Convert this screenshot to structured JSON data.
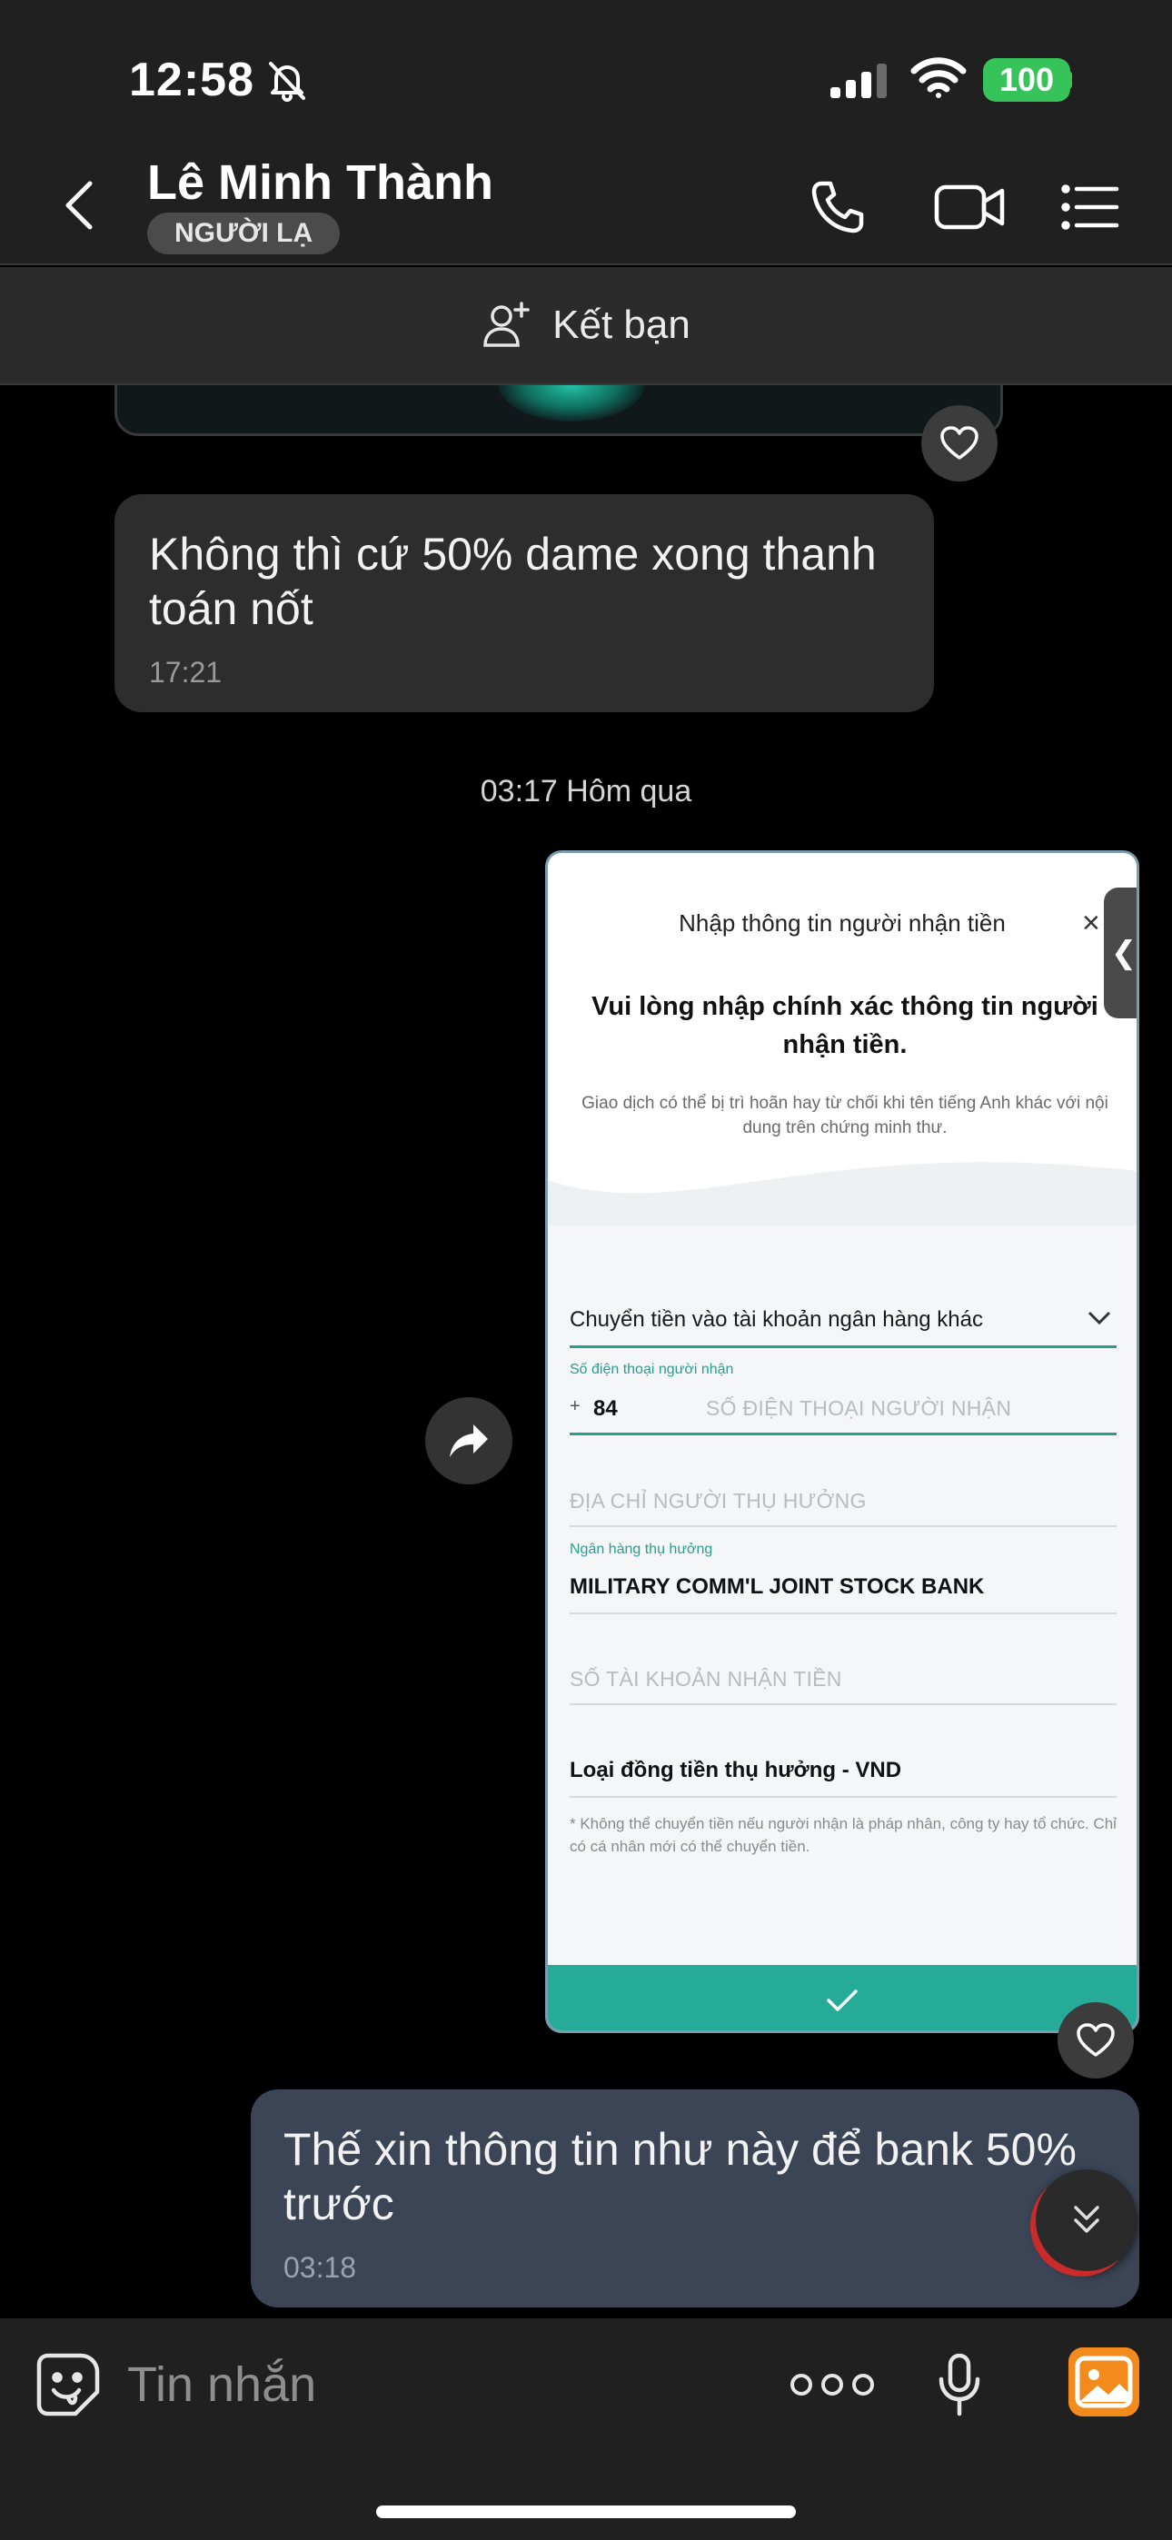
{
  "status_bar": {
    "time": "12:58",
    "battery": "100"
  },
  "header": {
    "contact_name": "Lê Minh Thành",
    "badge": "NGƯỜI LẠ",
    "icons": [
      "back-chevron-icon",
      "phone-icon",
      "video-camera-icon",
      "list-menu-icon"
    ]
  },
  "friend_bar": {
    "label": "Kết bạn"
  },
  "messages": {
    "incoming": {
      "text": "Không thì cứ 50% dame xong thanh toán nốt",
      "time": "17:21"
    },
    "date_separator": "03:17 Hôm qua",
    "screenshot": {
      "title": "Nhập thông tin người nhận tiền",
      "close": "×",
      "side_tab": "❮",
      "heading": "Vui lòng nhập chính xác thông tin người nhận tiền.",
      "note": "Giao dịch có thể bị trì hoãn hay từ chối khi tên tiếng Anh khác với nội dung trên chứng minh thư.",
      "transfer_type": "Chuyển tiền vào tài khoản ngân hàng khác",
      "phone_label": "Số điện thoại người nhận",
      "phone_plus": "+",
      "phone_code": "84",
      "phone_placeholder": "SỐ ĐIỆN THOẠI NGƯỜI NHẬN",
      "address_placeholder": "ĐỊA CHỈ NGƯỜI THỤ HƯỞNG",
      "bank_label": "Ngân hàng thụ hưởng",
      "bank_value": "MILITARY COMM'L JOINT STOCK BANK",
      "account_placeholder": "SỐ TÀI KHOẢN NHẬN TIỀN",
      "currency": "Loại đồng tiền thụ hưởng - VND",
      "footnote": "* Không thể chuyển tiền nếu người nhận là pháp nhân, công ty hay tổ chức. Chỉ có cá nhân mới có thể chuyển tiền."
    },
    "outgoing": {
      "text": "Thế xin thông tin như này để bank 50% trước",
      "time": "03:18"
    }
  },
  "composer": {
    "placeholder": "Tin nhắn"
  },
  "colors": {
    "accent_teal": "#26ab98",
    "battery_green": "#36c35a",
    "outgoing_bubble": "#3b4556",
    "photo_orange": "#f28a1c"
  }
}
